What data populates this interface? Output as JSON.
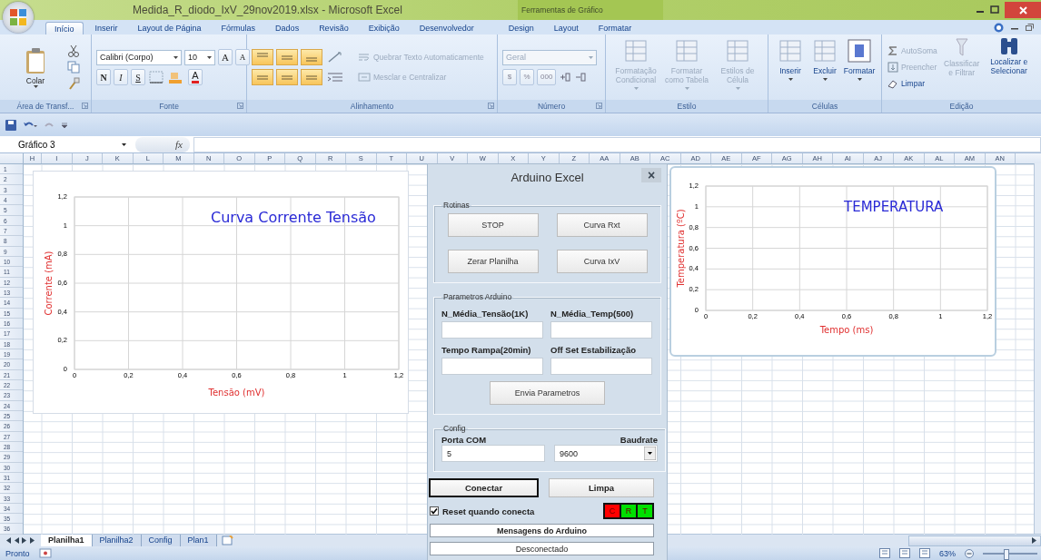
{
  "window": {
    "title": "Medida_R_diodo_IxV_29nov2019.xlsx - Microsoft Excel",
    "context_title": "Ferramentas de Gráfico"
  },
  "ribbon_tabs": [
    {
      "label": "Início",
      "selected": true
    },
    {
      "label": "Inserir",
      "selected": false
    },
    {
      "label": "Layout de Página",
      "selected": false
    },
    {
      "label": "Fórmulas",
      "selected": false
    },
    {
      "label": "Dados",
      "selected": false
    },
    {
      "label": "Revisão",
      "selected": false
    },
    {
      "label": "Exibição",
      "selected": false
    },
    {
      "label": "Desenvolvedor",
      "selected": false
    },
    {
      "label": "Design",
      "selected": false
    },
    {
      "label": "Layout",
      "selected": false
    },
    {
      "label": "Formatar",
      "selected": false
    }
  ],
  "ribbon_groups": [
    {
      "kind": "clipboard",
      "label": "Área de Transf...",
      "paste": "Colar"
    },
    {
      "kind": "font",
      "label": "Fonte",
      "font_name": "Calibri (Corpo)",
      "font_size": "10",
      "size_buttons": [
        "A",
        "A"
      ],
      "style_buttons": [
        "N",
        "I",
        "S"
      ],
      "color_button": "A"
    },
    {
      "kind": "alignment",
      "label": "Alinhamento",
      "commands": [
        {
          "label": "Quebrar Texto Automaticamente",
          "disabled": true
        },
        {
          "label": "Mesclar e Centralizar",
          "disabled": true
        }
      ]
    },
    {
      "kind": "number",
      "label": "Número",
      "format": "Geral",
      "disabled": true,
      "buttons": [
        "$",
        "%",
        "000"
      ]
    },
    {
      "kind": "large",
      "label": "Estilo",
      "buttons": [
        {
          "label": "Formatação Condicional",
          "disabled": true
        },
        {
          "label": "Formatar como Tabela",
          "disabled": true
        },
        {
          "label": "Estilos de Célula",
          "disabled": true
        }
      ]
    },
    {
      "kind": "large",
      "label": "Células",
      "buttons": [
        {
          "label": "Inserir",
          "disabled": false
        },
        {
          "label": "Excluir",
          "disabled": false
        },
        {
          "label": "Formatar",
          "disabled": false
        }
      ]
    },
    {
      "kind": "editing",
      "label": "Edição",
      "commands": [
        {
          "label": "AutoSoma",
          "disabled": true
        },
        {
          "label": "Preencher",
          "disabled": true
        },
        {
          "label": "Limpar",
          "disabled": false
        }
      ],
      "buttons": [
        {
          "label": "Classificar e Filtrar",
          "disabled": true
        },
        {
          "label": "Localizar e Selecionar",
          "disabled": false
        }
      ]
    }
  ],
  "formula_bar": {
    "name_box": "Gráfico 3",
    "function_label": "fx"
  },
  "sheet": {
    "columns": [
      "H",
      "I",
      "J",
      "K",
      "L",
      "M",
      "N",
      "O",
      "P",
      "Q",
      "R",
      "S",
      "T",
      "U",
      "V",
      "W",
      "X",
      "Y",
      "Z",
      "AA",
      "AB",
      "AC",
      "AD",
      "AE",
      "AF",
      "AG",
      "AH",
      "AI",
      "AJ",
      "AK",
      "AL",
      "AM",
      "AN"
    ],
    "rows": [
      "1",
      "2",
      "3",
      "4",
      "5",
      "6",
      "7",
      "8",
      "9",
      "10",
      "11",
      "12",
      "13",
      "14",
      "15",
      "16",
      "17",
      "18",
      "19",
      "20",
      "21",
      "22",
      "23",
      "24",
      "25",
      "26",
      "27",
      "28",
      "29",
      "30",
      "31",
      "32",
      "33",
      "34",
      "35",
      "36"
    ]
  },
  "charts": [
    {
      "chart_data": {
        "type": "line",
        "grid": true,
        "title": "Curva Corrente Tensão",
        "xlabel": "Tensão (mV)",
        "ylabel": "Corrente (mA)",
        "xlim": [
          0,
          1.2
        ],
        "ylim": [
          0,
          1.2
        ],
        "xticks": [
          {
            "value": 0,
            "label": "0"
          },
          {
            "value": 0.2,
            "label": "0,2"
          },
          {
            "value": 0.4,
            "label": "0,4"
          },
          {
            "value": 0.6,
            "label": "0,6"
          },
          {
            "value": 0.8,
            "label": "0,8"
          },
          {
            "value": 1,
            "label": "1"
          },
          {
            "value": 1.2,
            "label": "1,2"
          }
        ],
        "yticks": [
          {
            "value": 0,
            "label": "0"
          },
          {
            "value": 0.2,
            "label": "0,2"
          },
          {
            "value": 0.4,
            "label": "0,4"
          },
          {
            "value": 0.6,
            "label": "0,6"
          },
          {
            "value": 0.8,
            "label": "0,8"
          },
          {
            "value": 1,
            "label": "1"
          },
          {
            "value": 1.2,
            "label": "1,2"
          }
        ]
      }
    },
    {
      "chart_data": {
        "type": "line",
        "grid": true,
        "title": "TEMPERATURA",
        "xlabel": "Tempo (ms)",
        "ylabel": "Temperatura (ºC)",
        "xlim": [
          0,
          1.2
        ],
        "ylim": [
          0,
          1.2
        ],
        "xticks": [
          {
            "value": 0,
            "label": "0"
          },
          {
            "value": 0.2,
            "label": "0,2"
          },
          {
            "value": 0.4,
            "label": "0,4"
          },
          {
            "value": 0.6,
            "label": "0,6"
          },
          {
            "value": 0.8,
            "label": "0,8"
          },
          {
            "value": 1,
            "label": "1"
          },
          {
            "value": 1.2,
            "label": "1,2"
          }
        ],
        "yticks": [
          {
            "value": 0,
            "label": "0"
          },
          {
            "value": 0.2,
            "label": "0,2"
          },
          {
            "value": 0.4,
            "label": "0,4"
          },
          {
            "value": 0.6,
            "label": "0,6"
          },
          {
            "value": 0.8,
            "label": "0,8"
          },
          {
            "value": 1,
            "label": "1"
          },
          {
            "value": 1.2,
            "label": "1,2"
          }
        ]
      }
    }
  ],
  "sheet_tabs": [
    {
      "label": "Planilha1",
      "selected": true
    },
    {
      "label": "Planilha2",
      "selected": false
    },
    {
      "label": "Config",
      "selected": false
    },
    {
      "label": "Plan1",
      "selected": false
    }
  ],
  "status_bar": {
    "status": "Pronto",
    "zoom": "63%",
    "zoom_slider": {
      "level": 0.42
    }
  },
  "dialog": {
    "title": "Arduino Excel",
    "close": "×",
    "routines": {
      "label": "Rotinas",
      "buttons": [
        "STOP",
        "Curva Rxt",
        "Zerar Planilha",
        "Curva IxV"
      ]
    },
    "parameters": {
      "label": "Parametros Arduino",
      "fields": [
        {
          "label": "N_Média_Tensão(1K)"
        },
        {
          "label": "N_Média_Temp(500)"
        },
        {
          "label": "Tempo Rampa(20min)"
        },
        {
          "label": "Off Set Estabilização"
        }
      ],
      "send_button": "Envia Parametros"
    },
    "config": {
      "label": "Config",
      "port_label": "Porta COM",
      "port_value": "5",
      "baud_label": "Baudrate",
      "baud_value": "9600"
    },
    "connect_button": {
      "label": "Conectar",
      "focused": true
    },
    "clear_button": "Limpa",
    "reset_checkbox": {
      "label": "Reset quando conecta",
      "checked": true
    },
    "leds": [
      {
        "label": "C",
        "color": "#ff0000"
      },
      {
        "label": "R",
        "color": "#00e000"
      },
      {
        "label": "T",
        "color": "#00e000"
      }
    ],
    "messages_title": "Mensagens do Arduino",
    "status": "Desconectado"
  }
}
